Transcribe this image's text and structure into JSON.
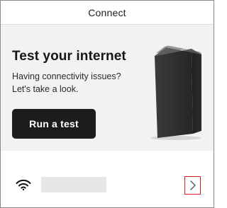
{
  "header": {
    "title": "Connect"
  },
  "hero": {
    "title": "Test your internet",
    "description_line1": "Having connectivity issues?",
    "description_line2": "Let's take a look.",
    "run_test_label": "Run a test"
  },
  "network": {
    "name": "",
    "status_icon": "wifi-icon",
    "action_icon": "chevron-right-icon"
  },
  "colors": {
    "button_bg": "#1c1c1e",
    "highlight": "#d62020",
    "page_bg": "#f2f2f2"
  }
}
